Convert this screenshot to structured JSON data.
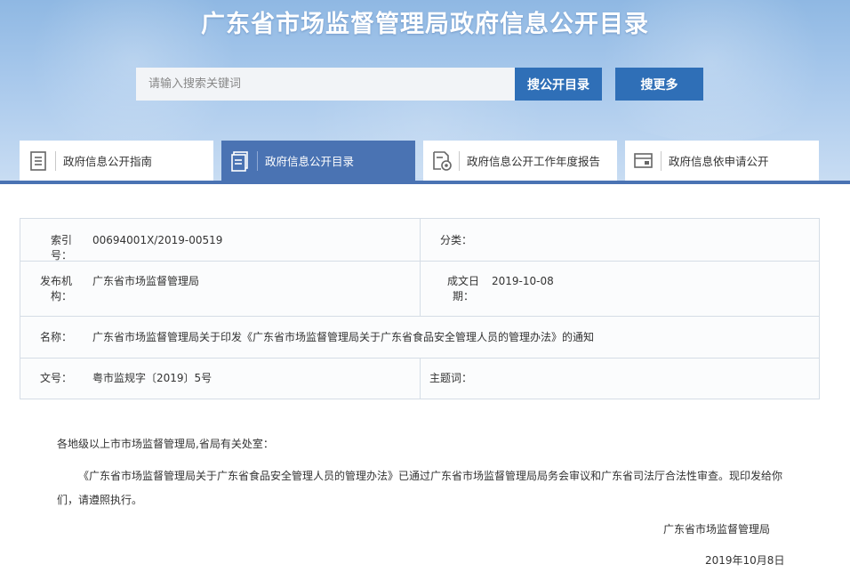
{
  "site": {
    "title": "广东省市场监督管理局政府信息公开目录"
  },
  "search": {
    "placeholder": "请输入搜索关键词",
    "value": "",
    "button_open": "搜公开目录",
    "button_more": "搜更多"
  },
  "tabs": [
    {
      "label": "政府信息公开指南",
      "icon": "document-list-icon",
      "active": false
    },
    {
      "label": "政府信息公开目录",
      "icon": "catalog-icon",
      "active": true
    },
    {
      "label": "政府信息公开工作年度报告",
      "icon": "report-icon",
      "active": false
    },
    {
      "label": "政府信息依申请公开",
      "icon": "application-icon",
      "active": false
    }
  ],
  "meta": {
    "index_label": "索引号：",
    "index_value": "00694001X/2019-00519",
    "category_label": "分类：",
    "category_value": "",
    "issuer_label_1": "发布机",
    "issuer_label_2": "构：",
    "issuer_value": "广东省市场监督管理局",
    "date_label_1": "成文日",
    "date_label_2": "期：",
    "date_value": "2019-10-08",
    "name_label": "名称：",
    "name_value": "广东省市场监督管理局关于印发《广东省市场监督管理局关于广东省食品安全管理人员的管理办法》的通知",
    "docno_label": "文号：",
    "docno_value": "粤市监规字〔2019〕5号",
    "subject_label": "主题词：",
    "subject_value": ""
  },
  "body": {
    "salutation": "各地级以上市市场监督管理局,省局有关处室：",
    "paragraph_line1": "《广东省市场监督管理局关于广东省食品安全管理人员的管理办法》已通过广东省市场监督管理局局务会审议和广东省司法厅合法性审查。现印发给你",
    "paragraph_line2": "们，请遵照执行。",
    "signature": "广东省市场监督管理局",
    "date": "2019年10月8日"
  },
  "colors": {
    "header_gradient_top": "#8fb8e3",
    "accent_blue": "#2f6fb7",
    "active_tab": "#4a73b3"
  }
}
